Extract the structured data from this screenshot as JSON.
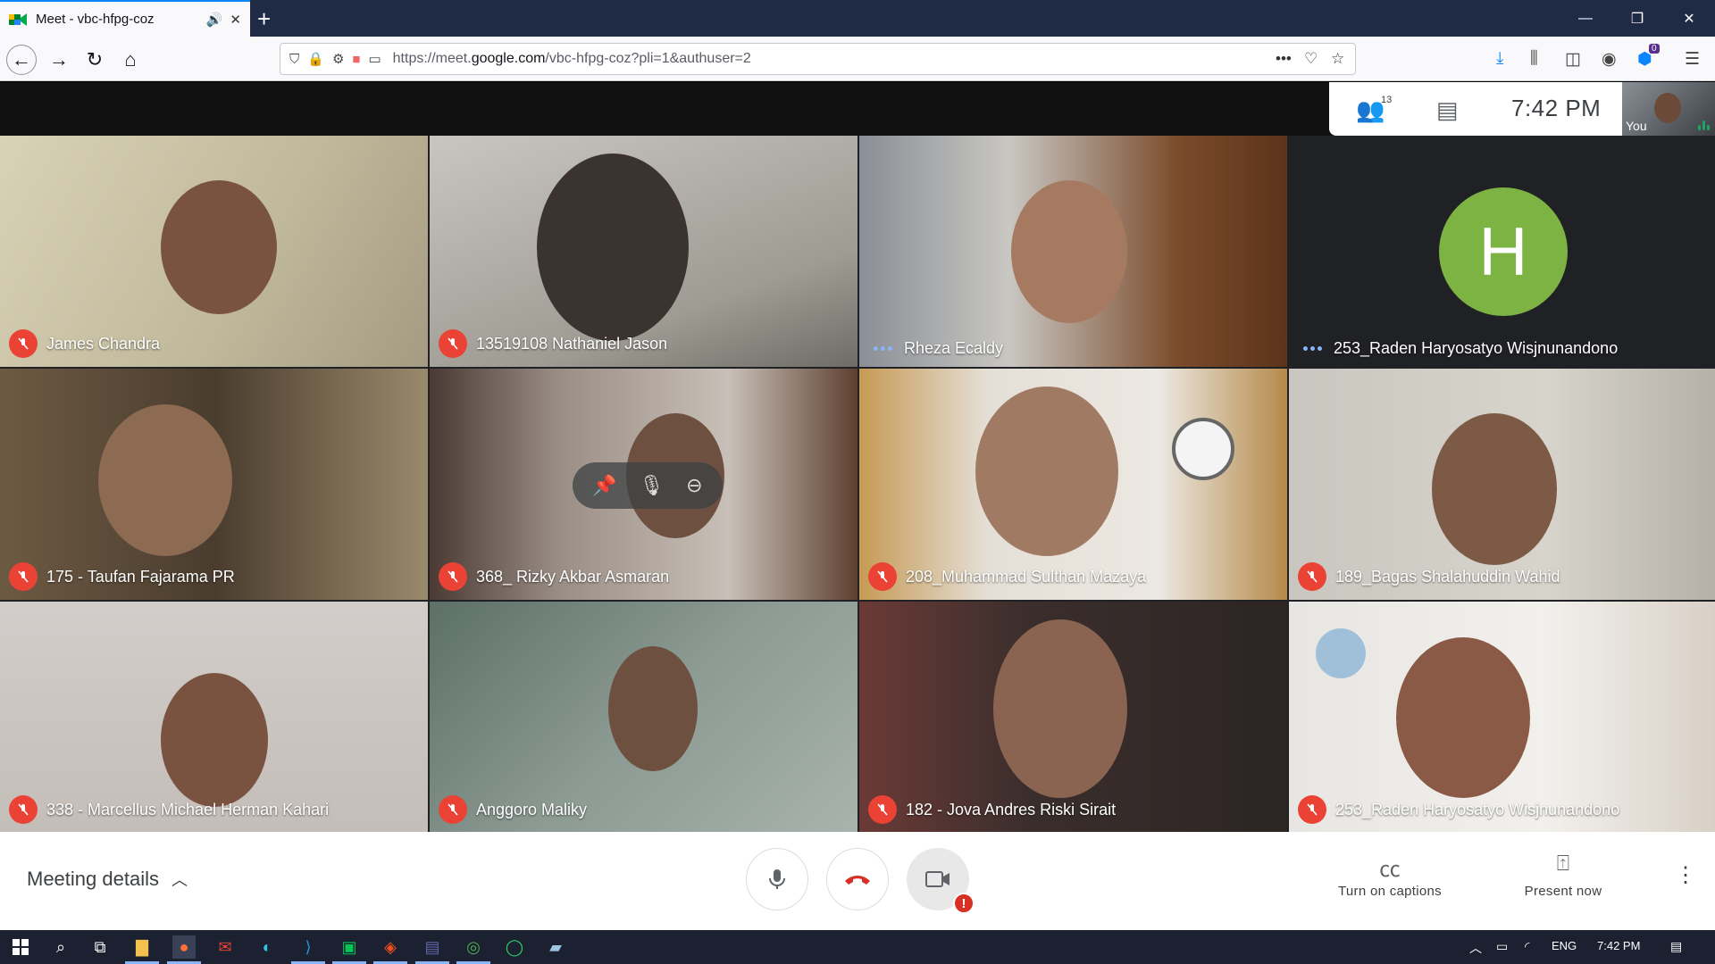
{
  "browser": {
    "tab_title": "Meet - vbc-hfpg-coz",
    "new_tab_label": "+",
    "url_prefix": "https://meet.",
    "url_domain": "google.com",
    "url_path": "/vbc-hfpg-coz?pli=1&authuser=2",
    "library_badge": "0"
  },
  "meet": {
    "participant_count": "13",
    "time": "7:42  PM",
    "self_label": "You",
    "tiles": [
      {
        "name": "James Chandra",
        "status": "muted"
      },
      {
        "name": "13519108 Nathaniel Jason",
        "status": "muted"
      },
      {
        "name": "Rheza Ecaldy",
        "status": "speaking"
      },
      {
        "name": "253_Raden Haryosatyo Wisjnunandono",
        "status": "speaking",
        "avatar_letter": "H"
      },
      {
        "name": "175 - Taufan Fajarama PR",
        "status": "muted"
      },
      {
        "name": "368_ Rizky Akbar Asmaran",
        "status": "muted"
      },
      {
        "name": "208_Muhammad Sulthan Mazaya",
        "status": "muted"
      },
      {
        "name": "189_Bagas Shalahuddin Wahid",
        "status": "muted"
      },
      {
        "name": "338 - Marcellus Michael Herman Kahari",
        "status": "muted"
      },
      {
        "name": "Anggoro Maliky",
        "status": "muted"
      },
      {
        "name": "182 - Jova Andres Riski Sirait",
        "status": "muted"
      },
      {
        "name": "253_Raden Haryosatyo Wisjnunandono",
        "status": "muted"
      }
    ],
    "meeting_details_label": "Meeting details",
    "captions_label": "Turn on captions",
    "present_label": "Present now",
    "camera_warning": "!"
  },
  "taskbar": {
    "language": "ENG",
    "time": "7:42 PM"
  },
  "colors": {
    "mute_red": "#ea4335",
    "speaking_blue": "#8ab4f8",
    "avatar_green": "#7cb342",
    "end_call_red": "#d93025"
  }
}
